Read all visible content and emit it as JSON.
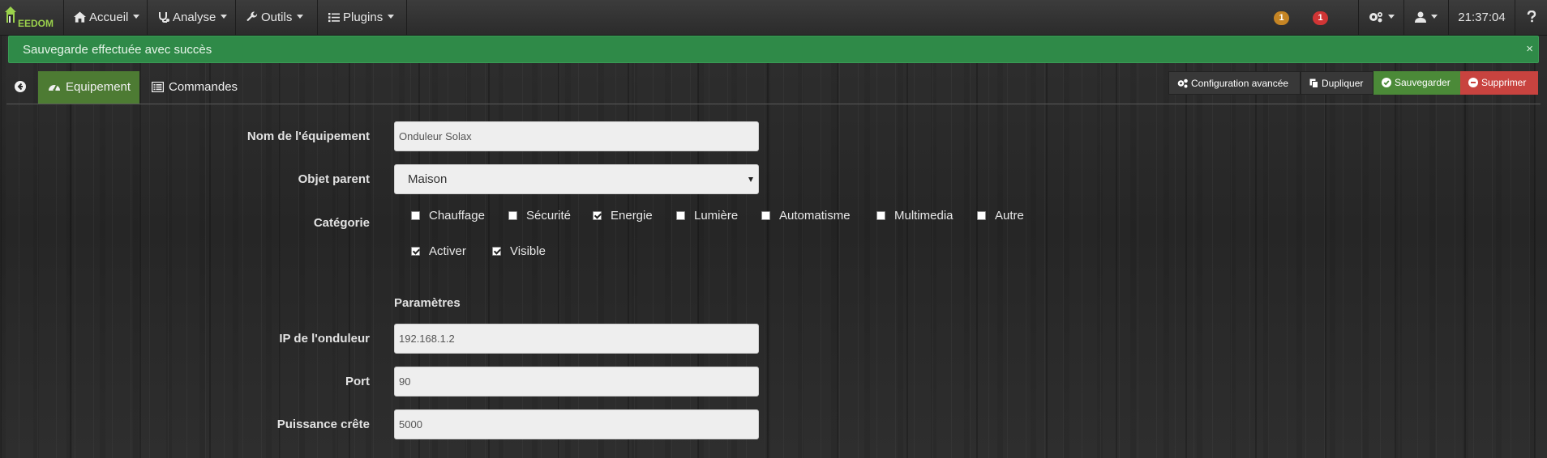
{
  "navbar": {
    "brand": "EEDOM",
    "menus": [
      {
        "label": "Accueil",
        "icon": "home-icon"
      },
      {
        "label": "Analyse",
        "icon": "stethoscope-icon"
      },
      {
        "label": "Outils",
        "icon": "wrench-icon"
      },
      {
        "label": "Plugins",
        "icon": "list-icon"
      }
    ],
    "badge_warning": "1",
    "badge_danger": "1",
    "time": "21:37:04",
    "colors": {
      "warning": "#c58524",
      "danger": "#d03535",
      "brand": "#9bd24c"
    }
  },
  "alert": {
    "message": "Sauvegarde effectuée avec succès",
    "close": "×",
    "color": "#2f8a48"
  },
  "tabs": [
    {
      "label": "Equipement",
      "icon": "dashboard-icon",
      "active": true
    },
    {
      "label": "Commandes",
      "icon": "list-alt-icon",
      "active": false
    }
  ],
  "toolbar": {
    "config_label": "Configuration avancée",
    "duplicate_label": "Dupliquer",
    "save_label": "Sauvegarder",
    "delete_label": "Supprimer"
  },
  "form": {
    "name_label": "Nom de l'équipement",
    "name_value": "Onduleur Solax",
    "parent_label": "Objet parent",
    "parent_value": "Maison",
    "category_label": "Catégorie",
    "categories": [
      {
        "label": "Chauffage",
        "checked": false
      },
      {
        "label": "Sécurité",
        "checked": false
      },
      {
        "label": "Energie",
        "checked": true
      },
      {
        "label": "Lumière",
        "checked": false
      },
      {
        "label": "Automatisme",
        "checked": false
      },
      {
        "label": "Multimedia",
        "checked": false
      },
      {
        "label": "Autre",
        "checked": false
      }
    ],
    "options": [
      {
        "label": "Activer",
        "checked": true
      },
      {
        "label": "Visible",
        "checked": true
      }
    ],
    "params_title": "Paramètres",
    "ip_label": "IP de l'onduleur",
    "ip_value": "192.168.1.2",
    "port_label": "Port",
    "port_value": "90",
    "power_label": "Puissance crête",
    "power_value": "5000"
  }
}
